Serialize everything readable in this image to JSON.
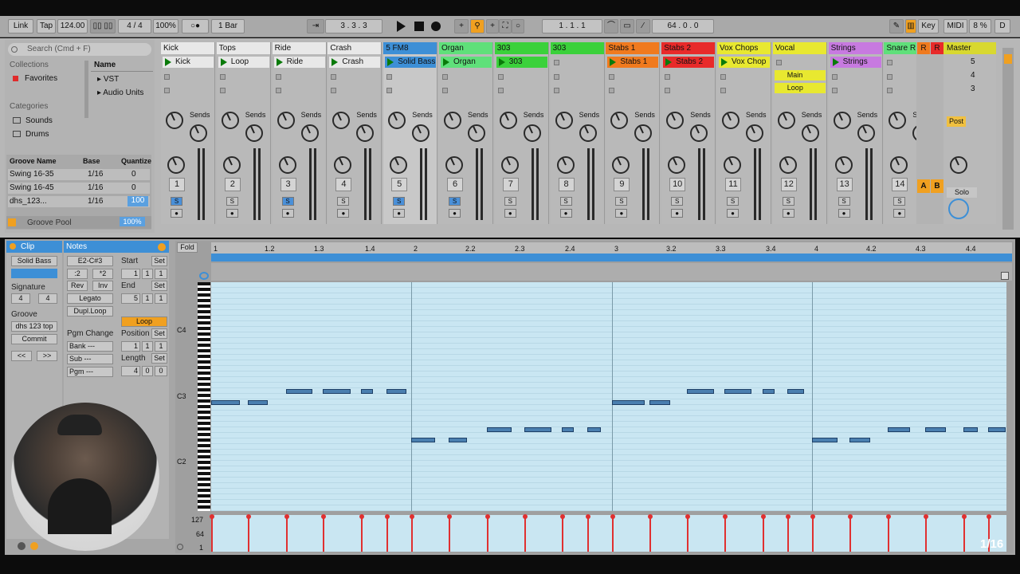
{
  "topbar": {
    "link": "Link",
    "tap": "Tap",
    "tempo": "124.00",
    "signature": "4 / 4",
    "zoom": "100%",
    "metro": "○●",
    "quantize": "1 Bar",
    "position": "3 . 3 . 3",
    "loop_start": "1 . 1 . 1",
    "loop_length": "64 . 0 . 0",
    "key": "Key",
    "midi": "MIDI",
    "cpu": "8 %",
    "d": "D"
  },
  "browser": {
    "search_placeholder": "Search (Cmd + F)",
    "collections_label": "Collections",
    "favorites": "Favorites",
    "categories_label": "Categories",
    "sounds": "Sounds",
    "drums": "Drums",
    "name_header": "Name",
    "items": [
      "VST",
      "Audio Units"
    ]
  },
  "groove": {
    "headers": [
      "Groove Name",
      "Base",
      "Quantize"
    ],
    "rows": [
      {
        "name": "Swing 16-35",
        "base": "1/16",
        "q": "0"
      },
      {
        "name": "Swing 16-45",
        "base": "1/16",
        "q": "0"
      },
      {
        "name": "dhs_123...",
        "base": "1/16",
        "q": "100"
      }
    ],
    "pool": "Groove Pool",
    "pool_value": "100%"
  },
  "tracks": [
    {
      "name": "Kick",
      "clip": "Kick",
      "num": "1",
      "color": "#e8e8e8",
      "clip_color": "#e8e8e8"
    },
    {
      "name": "Tops",
      "clip": "Loop",
      "num": "2",
      "color": "#e8e8e8",
      "clip_color": "#e8e8e8"
    },
    {
      "name": "Ride",
      "clip": "Ride",
      "num": "3",
      "color": "#e8e8e8",
      "clip_color": "#e8e8e8"
    },
    {
      "name": "Crash",
      "clip": "Crash",
      "num": "4",
      "color": "#e8e8e8",
      "clip_color": "#e8e8e8"
    },
    {
      "name": "5 FM8",
      "clip": "Solid Bass",
      "num": "5",
      "color": "#3d8fd6",
      "clip_color": "#3d8fd6"
    },
    {
      "name": "Organ",
      "clip": "Organ",
      "num": "6",
      "color": "#5fe07a",
      "clip_color": "#5fe07a"
    },
    {
      "name": "303",
      "clip": "303",
      "num": "7",
      "color": "#3bd13b",
      "clip_color": "#3bd13b"
    },
    {
      "name": "303",
      "clip": "",
      "num": "8",
      "color": "#3bd13b",
      "clip_color": "#b9b9b9"
    },
    {
      "name": "Stabs 1",
      "clip": "Stabs 1",
      "num": "9",
      "color": "#f07a1e",
      "clip_color": "#f07a1e"
    },
    {
      "name": "Stabs 2",
      "clip": "Stabs 2",
      "num": "10",
      "color": "#e82a2a",
      "clip_color": "#e82a2a"
    },
    {
      "name": "Vox Chops",
      "clip": "Vox Chop",
      "num": "11",
      "color": "#e8e830",
      "clip_color": "#e8e830"
    },
    {
      "name": "Vocal",
      "clip": "",
      "num": "12",
      "color": "#e8e830",
      "clip_color": "#b9b9b9"
    },
    {
      "name": "Strings",
      "clip": "Strings",
      "num": "13",
      "color": "#c77ae0",
      "clip_color": "#c77ae0"
    },
    {
      "name": "Snare R",
      "clip": "",
      "num": "14",
      "color": "#5fe07a",
      "clip_color": "#b9b9b9"
    }
  ],
  "vocal_clips": [
    "Main",
    "Loop"
  ],
  "master": {
    "name": "Master",
    "scenes": [
      "5",
      "4",
      "3"
    ],
    "post": "Post",
    "solo": "Solo"
  },
  "returns": [
    "R",
    "R"
  ],
  "ab": [
    "A",
    "B"
  ],
  "sends_label": "Sends",
  "clip_view": {
    "tab": "Clip",
    "name": "Solid Bass",
    "signature_label": "Signature",
    "sig_num": "4",
    "sig_den": "4",
    "groove_label": "Groove",
    "groove_value": "dhs 123 top",
    "commit": "Commit"
  },
  "notes_view": {
    "tab": "Notes",
    "range": "E2-C#3",
    "div2": ":2",
    "mul2": "*2",
    "rev": "Rev",
    "inv": "Inv",
    "legato": "Legato",
    "dupl": "Dupl.Loop",
    "pgm": "Pgm Change",
    "bank": "Bank ---",
    "sub": "Sub ---",
    "pgm_val": "Pgm ---",
    "start": "Start",
    "end": "End",
    "loop": "Loop",
    "position": "Position",
    "length": "Length",
    "set": "Set",
    "start_val": [
      "1",
      "1",
      "1"
    ],
    "end_val": [
      "5",
      "1",
      "1"
    ],
    "pos_val": [
      "1",
      "1",
      "1"
    ],
    "len_val": [
      "4",
      "0",
      "0"
    ]
  },
  "roll": {
    "fold": "Fold",
    "ruler": [
      "1",
      "1.2",
      "1.3",
      "1.4",
      "2",
      "2.2",
      "2.3",
      "2.4",
      "3",
      "3.2",
      "3.3",
      "3.4",
      "4",
      "4.2",
      "4.3",
      "4.4"
    ],
    "keys": [
      "C4",
      "C3",
      "C2"
    ],
    "vel": [
      "127",
      "64",
      "1"
    ],
    "grid": "1/16"
  }
}
